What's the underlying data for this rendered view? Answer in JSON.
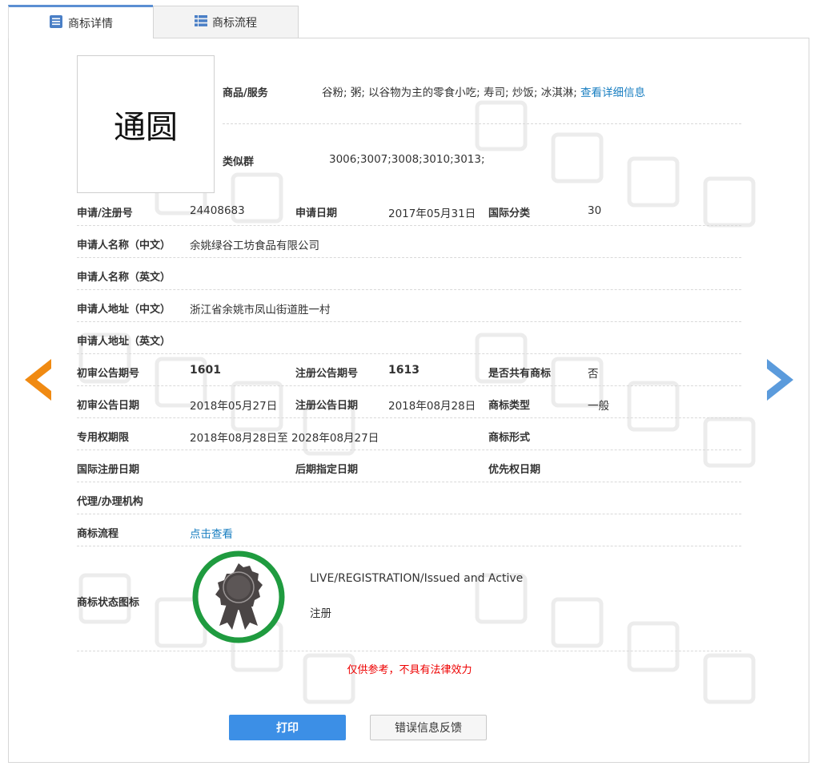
{
  "tabs": {
    "detail_label": "商标详情",
    "flow_label": "商标流程"
  },
  "mark": {
    "text": "通圆"
  },
  "goods_services": {
    "label": "商品/服务",
    "value": "谷粉; 粥; 以谷物为主的零食小吃; 寿司; 炒饭; 冰淇淋;",
    "link": "查看详细信息"
  },
  "similar_group": {
    "label": "类似群",
    "value": "3006;3007;3008;3010;3013;"
  },
  "fields": {
    "reg_no_label": "申请/注册号",
    "reg_no_value": "24408683",
    "apply_date_label": "申请日期",
    "apply_date_value": "2017年05月31日",
    "intl_class_label": "国际分类",
    "intl_class_value": "30",
    "applicant_cn_label": "申请人名称（中文）",
    "applicant_cn_value": "余姚绿谷工坊食品有限公司",
    "applicant_en_label": "申请人名称（英文）",
    "address_cn_label": "申请人地址（中文）",
    "address_cn_value": "浙江省余姚市凤山街道胜一村",
    "address_en_label": "申请人地址（英文）",
    "prelim_issue_label": "初审公告期号",
    "prelim_issue_value": "1601",
    "reg_issue_label": "注册公告期号",
    "reg_issue_value": "1613",
    "shared_label": "是否共有商标",
    "shared_value": "否",
    "prelim_date_label": "初审公告日期",
    "prelim_date_value": "2018年05月27日",
    "reg_date_label": "注册公告日期",
    "reg_date_value": "2018年08月28日",
    "mark_type_label": "商标类型",
    "mark_type_value": "一般",
    "exclusive_label": "专用权期限",
    "exclusive_value": "2018年08月28日至 2028年08月27日",
    "mark_form_label": "商标形式",
    "intl_reg_date_label": "国际注册日期",
    "later_designation_label": "后期指定日期",
    "priority_date_label": "优先权日期",
    "agency_label": "代理/办理机构",
    "flow_label": "商标流程",
    "flow_link": "点击查看",
    "status_icon_label": "商标状态图标",
    "status_en": "LIVE/REGISTRATION/Issued and Active",
    "status_cn": "注册"
  },
  "notice": "仅供参考，不具有法律效力",
  "buttons": {
    "print": "打印",
    "feedback": "错误信息反馈"
  },
  "colors": {
    "accent": "#5b8fd3",
    "link": "#1a7fc1",
    "prev_arrow": "#f08a12",
    "next_arrow": "#5b9bdc",
    "status_ring": "#1f9b3f",
    "notice": "#e00000",
    "print_button": "#3c8fe6"
  }
}
